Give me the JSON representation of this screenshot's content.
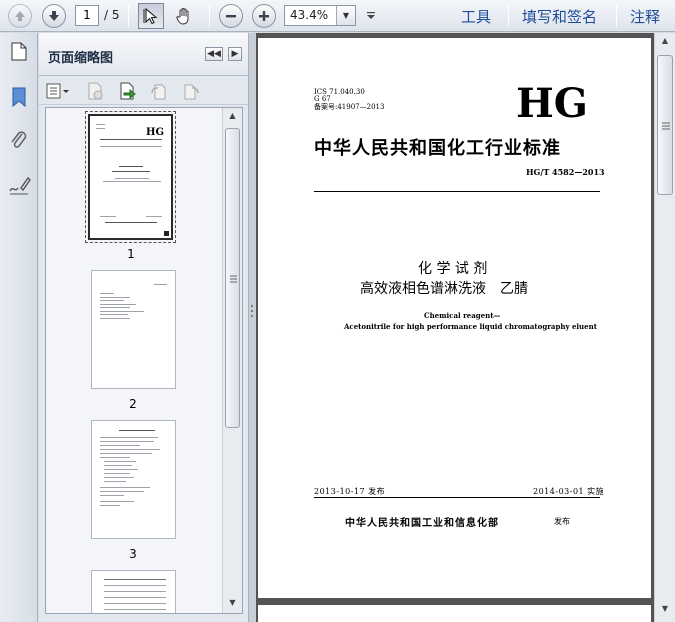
{
  "toolbar": {
    "page_current": "1",
    "page_total": "/ 5",
    "zoom": "43.4%",
    "tools_label": "工具",
    "fill_sign_label": "填写和签名",
    "comment_label": "注释"
  },
  "panel": {
    "title": "页面缩略图",
    "thumbnails": [
      {
        "label": "1"
      },
      {
        "label": "2"
      },
      {
        "label": "3"
      }
    ]
  },
  "document": {
    "ics": "ICS 71.040.30",
    "class_code": "G 67",
    "record_no": "备案号:41907—2013",
    "logo": "HG",
    "org_title": "中华人民共和国化工行业标准",
    "std_no": "HG/T 4582—2013",
    "title_line1": "化 学 试 剂",
    "title_line2": "高效液相色谱淋洗液　乙腈",
    "en_line1": "Chemical reagent—",
    "en_line2": "Acetonitrile for high performance liquid chromatography eluent",
    "publish_date": "2013-10-17 发布",
    "impl_date": "2014-03-01 实施",
    "issuer": "中华人民共和国工业和信息化部",
    "issue_word": "发布"
  }
}
